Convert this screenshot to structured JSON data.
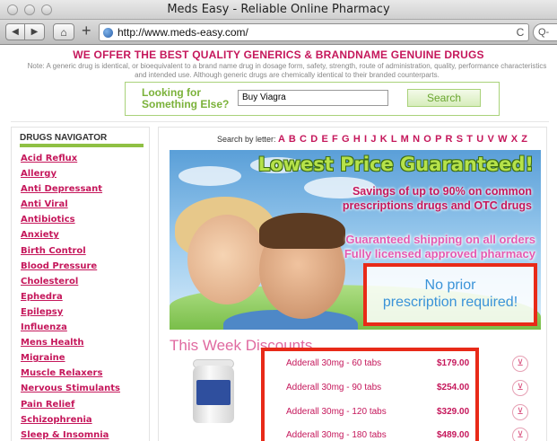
{
  "window": {
    "title": "Meds Easy - Reliable Online Pharmacy"
  },
  "toolbar": {
    "back_icon": "back-arrow-icon",
    "forward_icon": "forward-arrow-icon",
    "home_icon": "home-icon",
    "add_icon": "plus-icon",
    "url": "http://www.meds-easy.com/",
    "reload_icon": "reload-icon",
    "search_label": "Q-"
  },
  "header": {
    "offer": "WE OFFER THE BEST QUALITY GENERICS & BRANDNAME GENUINE DRUGS",
    "note": "Note: A generic drug is identical, or bioequivalent to a brand name drug in dosage form, safety, strength, route of administration, quality, performance characteristics and intended use. Although generic drugs are chemically identical to their branded counterparts."
  },
  "search": {
    "label_line1": "Looking for",
    "label_line2": "Something Else?",
    "value": "Buy Viagra",
    "button": "Search"
  },
  "sidebar": {
    "title": "DRUGS NAVIGATOR",
    "items": [
      "Acid Reflux",
      "Allergy",
      "Anti Depressant",
      "Anti Viral",
      "Antibiotics",
      "Anxiety",
      "Birth Control",
      "Blood Pressure",
      "Cholesterol",
      "Ephedra",
      "Epilepsy",
      "Influenza",
      "Mens Health",
      "Migraine",
      "Muscle Relaxers",
      "Nervous Stimulants",
      "Pain Relief",
      "Schizophrenia",
      "Sleep & Insomnia"
    ]
  },
  "main": {
    "search_by_letter": "Search by letter:",
    "letters": "A B C D E F G H I J K L M N O P R S T U V W X Z",
    "banner": {
      "headline": "Lowest Price Guaranteed!",
      "savings_line1": "Savings of up to 90% on common",
      "savings_line2": "prescriptions drugs and OTC drugs",
      "shipping_line1": "Guaranteed shipping on all orders",
      "shipping_line2": "Fully licensed approved pharmacy",
      "no_prior_line1": "No prior",
      "no_prior_line2": "prescription required!"
    },
    "discounts_title": "This Week Discounts",
    "offers": [
      {
        "name": "Adderall 30mg - 60 tabs",
        "price": "$179.00"
      },
      {
        "name": "Adderall 30mg - 90 tabs",
        "price": "$254.00"
      },
      {
        "name": "Adderall 30mg - 120 tabs",
        "price": "$329.00"
      },
      {
        "name": "Adderall 30mg - 180 tabs",
        "price": "$489.00"
      }
    ],
    "cart_icon": "shopping-cart-icon"
  },
  "colors": {
    "accent": "#c5175b",
    "green": "#8fc044",
    "highlight_border": "#e82a18",
    "link_blue": "#3a93d8"
  }
}
